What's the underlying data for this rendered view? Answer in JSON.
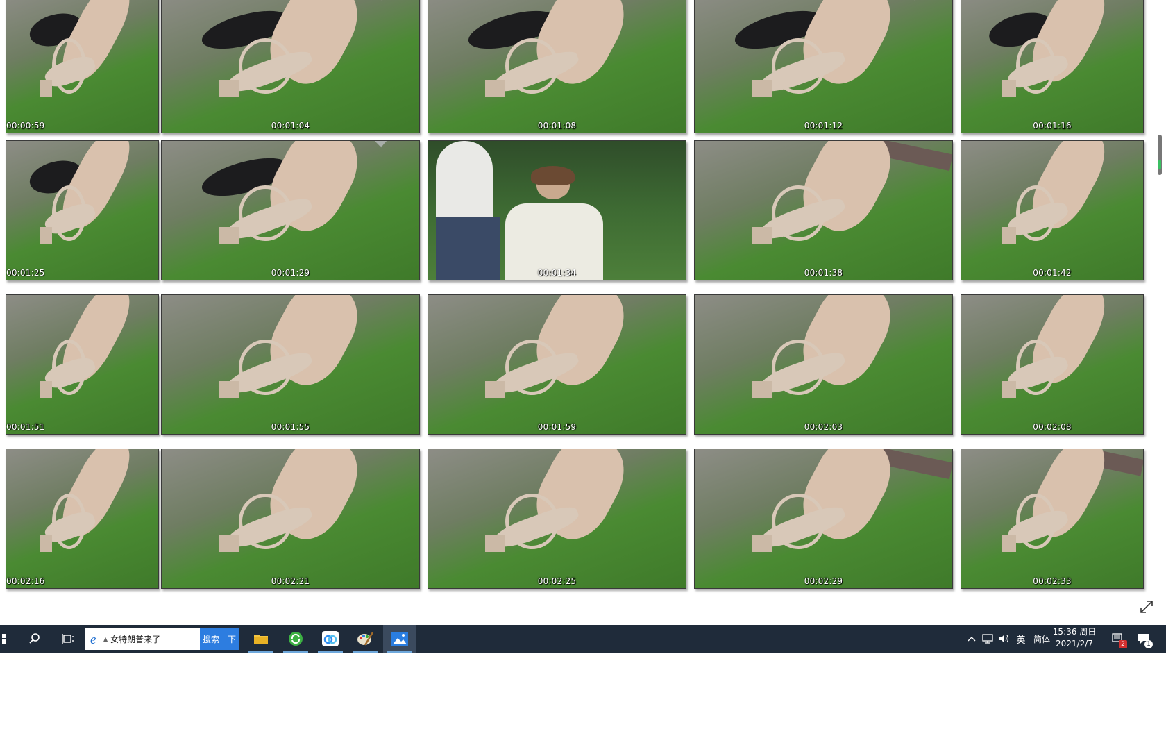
{
  "viewer": {
    "thumbnails": [
      {
        "ts": "00:00:59",
        "scene": "sandal-rail"
      },
      {
        "ts": "00:01:04",
        "scene": "sandal-rail"
      },
      {
        "ts": "00:01:08",
        "scene": "sandal-rail"
      },
      {
        "ts": "00:01:12",
        "scene": "sandal-rail"
      },
      {
        "ts": "00:01:16",
        "scene": "sandal-rail"
      },
      {
        "ts": "00:01:25",
        "scene": "sandal-rail"
      },
      {
        "ts": "00:01:29",
        "scene": "sandal-rail"
      },
      {
        "ts": "00:01:34",
        "scene": "people"
      },
      {
        "ts": "00:01:38",
        "scene": "legs-bench"
      },
      {
        "ts": "00:01:42",
        "scene": "legs-grass"
      },
      {
        "ts": "00:01:51",
        "scene": "sandal-grass"
      },
      {
        "ts": "00:01:55",
        "scene": "sandal-grass"
      },
      {
        "ts": "00:01:59",
        "scene": "sandal-grass"
      },
      {
        "ts": "00:02:03",
        "scene": "sandal-grass"
      },
      {
        "ts": "00:02:08",
        "scene": "sandal-grass"
      },
      {
        "ts": "00:02:16",
        "scene": "sandal-grass"
      },
      {
        "ts": "00:02:21",
        "scene": "sandal-grass"
      },
      {
        "ts": "00:02:25",
        "scene": "sandal-grass"
      },
      {
        "ts": "00:02:29",
        "scene": "legs-bench"
      },
      {
        "ts": "00:02:33",
        "scene": "legs-bench"
      }
    ]
  },
  "taskbar": {
    "search_text": "女特朗普来了",
    "search_button": "搜索一下",
    "ime_lang": "英",
    "ime_mode": "简体",
    "time": "15:36 周日",
    "date": "2021/2/7",
    "security_badge": "2",
    "notification_badge": "1"
  },
  "colors": {
    "taskbar": "#1f2b3a",
    "search_button": "#2d7de0",
    "grass": "#4a8a32",
    "pavement": "#8d8d86",
    "skin": "#d9c1ad",
    "sandal": "#d8c8b8"
  },
  "icons": [
    "start-icon",
    "search-icon",
    "task-view-icon",
    "ie-icon",
    "file-explorer-icon",
    "green-app-icon",
    "baidu-netdisk-icon",
    "paint-icon",
    "photos-icon",
    "chevron-up-icon",
    "network-icon",
    "volume-icon",
    "security-center-icon",
    "notification-icon",
    "expand-icon"
  ]
}
